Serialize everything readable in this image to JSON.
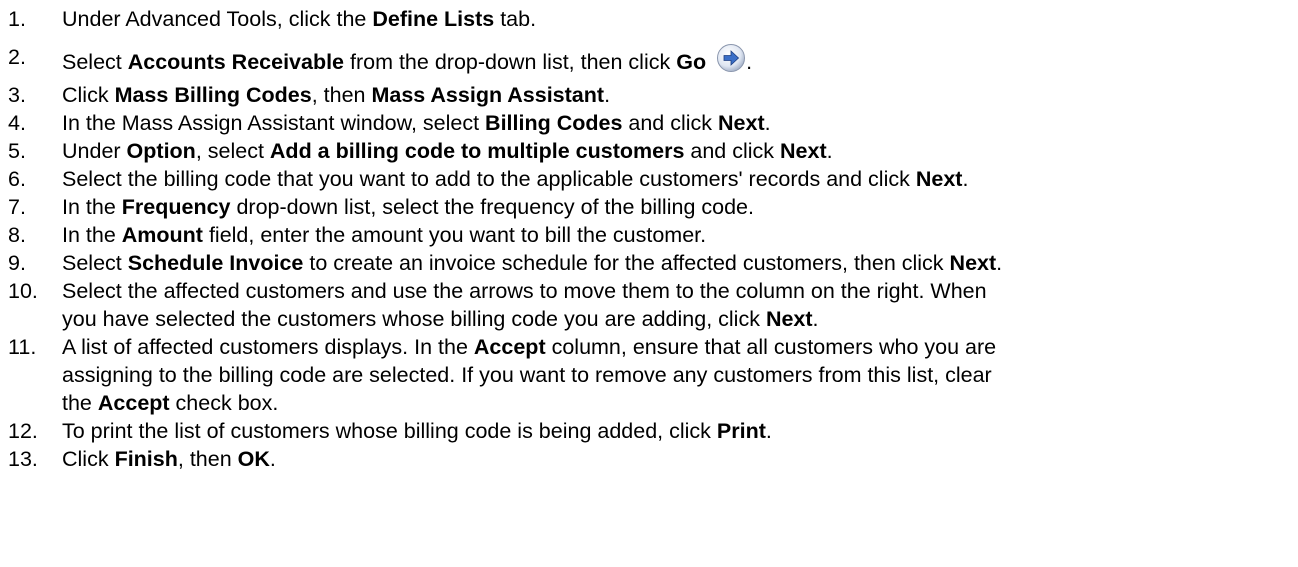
{
  "steps": [
    {
      "num": "1.",
      "parts": [
        {
          "t": "Under Advanced Tools, click the "
        },
        {
          "t": "Define Lists",
          "b": true
        },
        {
          "t": " tab."
        }
      ]
    },
    {
      "num": "2.",
      "parts": [
        {
          "t": "Select "
        },
        {
          "t": "Accounts Receivable",
          "b": true
        },
        {
          "t": " from the drop-down list, then click "
        },
        {
          "t": "Go",
          "b": true
        },
        {
          "t": " "
        },
        {
          "icon": "go-arrow-icon"
        },
        {
          "t": "."
        }
      ]
    },
    {
      "num": "3.",
      "parts": [
        {
          "t": "Click "
        },
        {
          "t": "Mass Billing Codes",
          "b": true
        },
        {
          "t": ", then "
        },
        {
          "t": "Mass Assign Assistant",
          "b": true
        },
        {
          "t": "."
        }
      ]
    },
    {
      "num": "4.",
      "parts": [
        {
          "t": "In the Mass Assign Assistant window, select "
        },
        {
          "t": "Billing Codes",
          "b": true
        },
        {
          "t": " and click "
        },
        {
          "t": "Next",
          "b": true
        },
        {
          "t": "."
        }
      ]
    },
    {
      "num": "5.",
      "parts": [
        {
          "t": "Under "
        },
        {
          "t": "Option",
          "b": true
        },
        {
          "t": ", select "
        },
        {
          "t": "Add a billing code to multiple customers",
          "b": true
        },
        {
          "t": " and click "
        },
        {
          "t": "Next",
          "b": true
        },
        {
          "t": "."
        }
      ]
    },
    {
      "num": "6.",
      "parts": [
        {
          "t": "Select the billing code that you want to add to the applicable customers' records and click "
        },
        {
          "t": "Next",
          "b": true
        },
        {
          "t": "."
        }
      ]
    },
    {
      "num": "7.",
      "parts": [
        {
          "t": "In the "
        },
        {
          "t": "Frequency",
          "b": true
        },
        {
          "t": " drop-down list, select the frequency of the billing code."
        }
      ]
    },
    {
      "num": "8.",
      "parts": [
        {
          "t": "In the "
        },
        {
          "t": "Amount",
          "b": true
        },
        {
          "t": " field, enter the amount you want to bill the customer."
        }
      ]
    },
    {
      "num": "9.",
      "parts": [
        {
          "t": "Select "
        },
        {
          "t": "Schedule Invoice",
          "b": true
        },
        {
          "t": " to create an invoice schedule for the affected customers, then click "
        },
        {
          "t": "Next",
          "b": true
        },
        {
          "t": "."
        }
      ]
    },
    {
      "num": "10.",
      "parts": [
        {
          "t": "Select the affected customers and use the arrows to move them to the column on the right. When"
        },
        {
          "br": true
        },
        {
          "t": "you have selected the customers whose billing code you are adding, click "
        },
        {
          "t": "Next",
          "b": true
        },
        {
          "t": "."
        }
      ]
    },
    {
      "num": "11.",
      "parts": [
        {
          "t": "A list of affected customers displays. In the "
        },
        {
          "t": "Accept",
          "b": true
        },
        {
          "t": " column, ensure that all customers who you are"
        },
        {
          "br": true
        },
        {
          "t": "assigning to the billing code are selected. If you want to remove any customers from this list, clear"
        },
        {
          "br": true
        },
        {
          "t": "the "
        },
        {
          "t": "Accept",
          "b": true
        },
        {
          "t": " check box."
        }
      ]
    },
    {
      "num": "12.",
      "parts": [
        {
          "t": "To print the list of customers whose billing code is being added, click "
        },
        {
          "t": "Print",
          "b": true
        },
        {
          "t": "."
        }
      ]
    },
    {
      "num": "13.",
      "parts": [
        {
          "t": "Click "
        },
        {
          "t": "Finish",
          "b": true
        },
        {
          "t": ", then "
        },
        {
          "t": "OK",
          "b": true
        },
        {
          "t": "."
        }
      ]
    }
  ],
  "icon_color": "#3b6fc7"
}
